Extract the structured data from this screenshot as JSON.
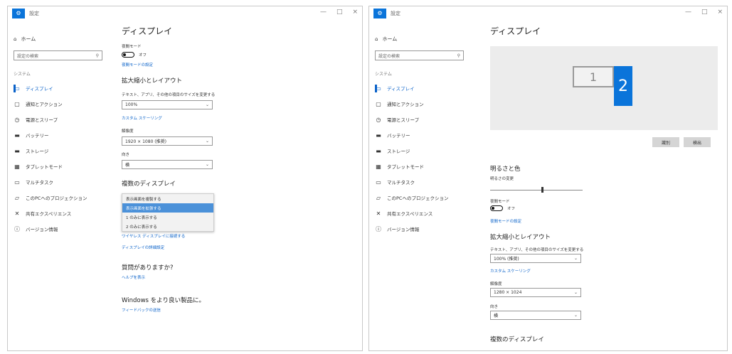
{
  "left_window": {
    "title": "設定",
    "controls": [
      "—",
      "□",
      "×"
    ],
    "nav": {
      "home": "ホーム",
      "search_placeholder": "設定の検索",
      "section": "システム",
      "items": [
        {
          "icon": "monitor-icon",
          "glyph": "▭",
          "label": "ディスプレイ",
          "active": true
        },
        {
          "icon": "chat-icon",
          "glyph": "▢",
          "label": "通知とアクション",
          "active": false
        },
        {
          "icon": "power-icon",
          "glyph": "◷",
          "label": "電源とスリープ",
          "active": false
        },
        {
          "icon": "battery-icon",
          "glyph": "▬",
          "label": "バッテリー",
          "active": false
        },
        {
          "icon": "storage-icon",
          "glyph": "▬",
          "label": "ストレージ",
          "active": false
        },
        {
          "icon": "tablet-icon",
          "glyph": "▦",
          "label": "タブレットモード",
          "active": false
        },
        {
          "icon": "multitask-icon",
          "glyph": "▭",
          "label": "マルチタスク",
          "active": false
        },
        {
          "icon": "project-icon",
          "glyph": "▱",
          "label": "このPCへのプロジェクション",
          "active": false
        },
        {
          "icon": "shared-icon",
          "glyph": "✕",
          "label": "共有エクスペリエンス",
          "active": false
        },
        {
          "icon": "info-icon",
          "glyph": "ⓘ",
          "label": "バージョン情報",
          "active": false
        }
      ]
    },
    "content": {
      "title": "ディスプレイ",
      "night_light_label": "夜間モード",
      "night_light_state": "オフ",
      "night_light_link": "夜間モードの設定",
      "scale_heading": "拡大縮小とレイアウト",
      "scale_label": "テキスト、アプリ、その他の項目のサイズを変更する",
      "scale_value": "100%",
      "custom_scale_link": "カスタム スケーリング",
      "resolution_label": "解像度",
      "resolution_value": "1920 × 1080 (推奨)",
      "orientation_label": "向き",
      "orientation_value": "横",
      "multi_heading": "複数のディスプレイ",
      "multi_options": [
        {
          "label": "表示画面を複製する",
          "selected": false
        },
        {
          "label": "表示画面を拡張する",
          "selected": true
        },
        {
          "label": "1 のみに表示する",
          "selected": false
        },
        {
          "label": "2 のみに表示する",
          "selected": false
        }
      ],
      "wireless_link": "ワイヤレス ディスプレイに接続する",
      "advanced_link": "ディスプレイの詳細設定",
      "question_heading": "質問がありますか?",
      "help_link": "ヘルプを表示",
      "windows_heading": "Windows をより良い製品に。",
      "feedback_link": "フィードバックの送信"
    }
  },
  "right_window": {
    "title": "設定",
    "controls": [
      "—",
      "□",
      "×"
    ],
    "nav": {
      "home": "ホーム",
      "search_placeholder": "設定の検索",
      "section": "システム",
      "items": [
        {
          "icon": "monitor-icon",
          "glyph": "▭",
          "label": "ディスプレイ",
          "active": true
        },
        {
          "icon": "chat-icon",
          "glyph": "▢",
          "label": "通知とアクション",
          "active": false
        },
        {
          "icon": "power-icon",
          "glyph": "◷",
          "label": "電源とスリープ",
          "active": false
        },
        {
          "icon": "battery-icon",
          "glyph": "▬",
          "label": "バッテリー",
          "active": false
        },
        {
          "icon": "storage-icon",
          "glyph": "▬",
          "label": "ストレージ",
          "active": false
        },
        {
          "icon": "tablet-icon",
          "glyph": "▦",
          "label": "タブレットモード",
          "active": false
        },
        {
          "icon": "multitask-icon",
          "glyph": "▭",
          "label": "マルチタスク",
          "active": false
        },
        {
          "icon": "project-icon",
          "glyph": "▱",
          "label": "このPCへのプロジェクション",
          "active": false
        },
        {
          "icon": "shared-icon",
          "glyph": "✕",
          "label": "共有エクスペリエンス",
          "active": false
        },
        {
          "icon": "info-icon",
          "glyph": "ⓘ",
          "label": "バージョン情報",
          "active": false
        }
      ]
    },
    "content": {
      "title": "ディスプレイ",
      "monitor_1": "1",
      "monitor_2": "2",
      "identify_button": "識別",
      "detect_button": "検出",
      "color_heading": "明るさと色",
      "brightness_label": "明るさの変更",
      "brightness_level": 0.55,
      "night_light_label": "夜間モード",
      "night_light_state": "オフ",
      "night_light_link": "夜間モードの設定",
      "scale_heading": "拡大縮小とレイアウト",
      "scale_label": "テキスト、アプリ、その他の項目のサイズを変更する",
      "scale_value": "100% (推奨)",
      "custom_scale_link": "カスタム スケーリング",
      "resolution_label": "解像度",
      "resolution_value": "1280 × 1024",
      "orientation_label": "向き",
      "orientation_value": "横",
      "multi_heading": "複数のディスプレイ"
    }
  }
}
